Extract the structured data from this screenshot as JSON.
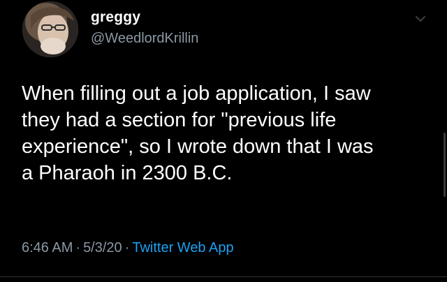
{
  "tweet": {
    "author": {
      "display_name": "greggy",
      "handle": "@WeedlordKrillin",
      "avatar_icon": "profile-photo"
    },
    "text_lines": [
      "When filling out a job application, I saw",
      "they had a section for \"previous life",
      "experience\", so I wrote down that I was",
      "a Pharaoh in 2300 B.C."
    ],
    "meta": {
      "time": "6:46 AM",
      "date": "5/3/20",
      "separator": "·",
      "source": "Twitter Web App"
    },
    "menu_icon": "chevron-down-icon"
  },
  "colors": {
    "background": "#000000",
    "text": "#ffffff",
    "secondary_text": "#8b98a5",
    "link": "#1da1f2"
  }
}
